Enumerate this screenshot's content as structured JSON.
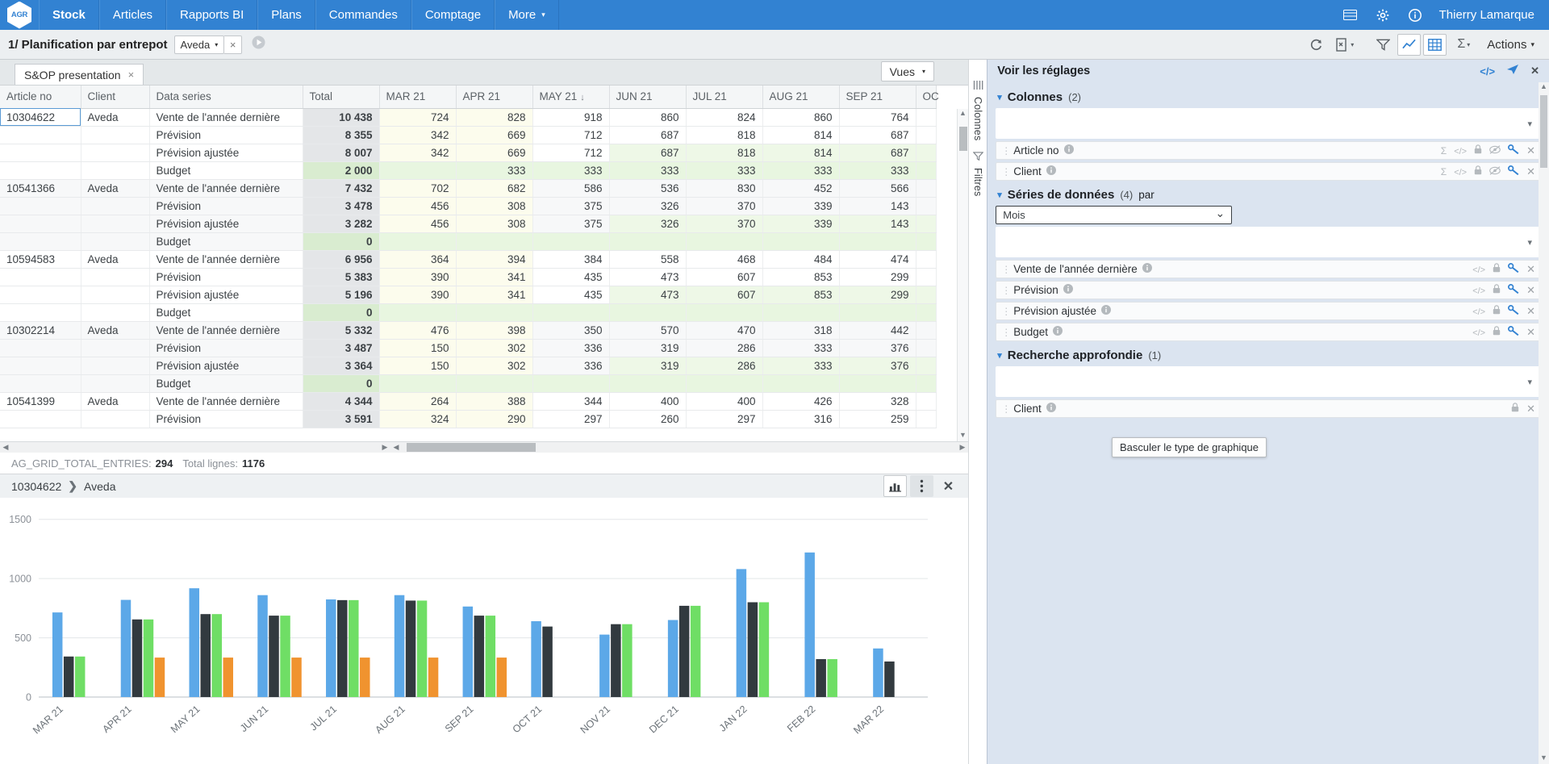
{
  "topnav": {
    "logo": "AGR",
    "items": [
      {
        "label": "Stock",
        "active": true
      },
      {
        "label": "Articles",
        "active": false
      },
      {
        "label": "Rapports BI",
        "active": false
      },
      {
        "label": "Plans",
        "active": false
      },
      {
        "label": "Commandes",
        "active": false
      },
      {
        "label": "Comptage",
        "active": false
      },
      {
        "label": "More",
        "active": false
      }
    ],
    "more_caret": "▾",
    "icons": [
      "book-icon",
      "gear-icon",
      "info-icon"
    ],
    "user": "Thierry Lamarque"
  },
  "titlebar": {
    "title": "1/ Planification par entrepot",
    "chip_label": "Aveda",
    "chip_caret": "▾",
    "chip_close": "×",
    "play_icon": "▶",
    "tools": [
      "refresh-icon",
      "export-icon",
      "filter-icon",
      "chart-icon",
      "grid-icon",
      "sigma-icon"
    ],
    "actions_label": "Actions",
    "actions_caret": "▾"
  },
  "tabs": {
    "items": [
      {
        "label": "S&OP presentation",
        "close": "×"
      }
    ],
    "vues_label": "Vues",
    "vues_caret": "▾"
  },
  "grid": {
    "columns": [
      "Article no",
      "Client",
      "Data series",
      "Total",
      "MAR 21",
      "APR 21",
      "MAY 21",
      "JUN 21",
      "JUL 21",
      "AUG 21",
      "SEP 21",
      "OC"
    ],
    "sorted_column": "MAY 21",
    "sort_arrow": "↓",
    "rows": [
      {
        "article": "10304622",
        "client": "Aveda",
        "series": "Vente de l'année dernière",
        "total": "10 438",
        "values": [
          "724",
          "828",
          "918",
          "860",
          "824",
          "860",
          "764",
          ""
        ]
      },
      {
        "article": "",
        "client": "",
        "series": "Prévision",
        "total": "8 355",
        "values": [
          "342",
          "669",
          "712",
          "687",
          "818",
          "814",
          "687",
          ""
        ]
      },
      {
        "article": "",
        "client": "",
        "series": "Prévision ajustée",
        "total": "8 007",
        "values": [
          "342",
          "669",
          "712",
          "687",
          "818",
          "814",
          "687",
          ""
        ]
      },
      {
        "article": "",
        "client": "",
        "series": "Budget",
        "total": "2 000",
        "values": [
          "",
          "333",
          "333",
          "333",
          "333",
          "333",
          "333",
          ""
        ]
      },
      {
        "article": "10541366",
        "client": "Aveda",
        "series": "Vente de l'année dernière",
        "total": "7 432",
        "values": [
          "702",
          "682",
          "586",
          "536",
          "830",
          "452",
          "566",
          ""
        ]
      },
      {
        "article": "",
        "client": "",
        "series": "Prévision",
        "total": "3 478",
        "values": [
          "456",
          "308",
          "375",
          "326",
          "370",
          "339",
          "143",
          ""
        ]
      },
      {
        "article": "",
        "client": "",
        "series": "Prévision ajustée",
        "total": "3 282",
        "values": [
          "456",
          "308",
          "375",
          "326",
          "370",
          "339",
          "143",
          ""
        ]
      },
      {
        "article": "",
        "client": "",
        "series": "Budget",
        "total": "0",
        "values": [
          "",
          "",
          "",
          "",
          "",
          "",
          "",
          ""
        ]
      },
      {
        "article": "10594583",
        "client": "Aveda",
        "series": "Vente de l'année dernière",
        "total": "6 956",
        "values": [
          "364",
          "394",
          "384",
          "558",
          "468",
          "484",
          "474",
          ""
        ]
      },
      {
        "article": "",
        "client": "",
        "series": "Prévision",
        "total": "5 383",
        "values": [
          "390",
          "341",
          "435",
          "473",
          "607",
          "853",
          "299",
          ""
        ]
      },
      {
        "article": "",
        "client": "",
        "series": "Prévision ajustée",
        "total": "5 196",
        "values": [
          "390",
          "341",
          "435",
          "473",
          "607",
          "853",
          "299",
          ""
        ]
      },
      {
        "article": "",
        "client": "",
        "series": "Budget",
        "total": "0",
        "values": [
          "",
          "",
          "",
          "",
          "",
          "",
          "",
          ""
        ]
      },
      {
        "article": "10302214",
        "client": "Aveda",
        "series": "Vente de l'année dernière",
        "total": "5 332",
        "values": [
          "476",
          "398",
          "350",
          "570",
          "470",
          "318",
          "442",
          ""
        ]
      },
      {
        "article": "",
        "client": "",
        "series": "Prévision",
        "total": "3 487",
        "values": [
          "150",
          "302",
          "336",
          "319",
          "286",
          "333",
          "376",
          ""
        ]
      },
      {
        "article": "",
        "client": "",
        "series": "Prévision ajustée",
        "total": "3 364",
        "values": [
          "150",
          "302",
          "336",
          "319",
          "286",
          "333",
          "376",
          ""
        ]
      },
      {
        "article": "",
        "client": "",
        "series": "Budget",
        "total": "0",
        "values": [
          "",
          "",
          "",
          "",
          "",
          "",
          "",
          ""
        ]
      },
      {
        "article": "10541399",
        "client": "Aveda",
        "series": "Vente de l'année dernière",
        "total": "4 344",
        "values": [
          "264",
          "388",
          "344",
          "400",
          "400",
          "426",
          "328",
          ""
        ]
      },
      {
        "article": "",
        "client": "",
        "series": "Prévision",
        "total": "3 591",
        "values": [
          "324",
          "290",
          "297",
          "260",
          "297",
          "316",
          "259",
          ""
        ]
      }
    ]
  },
  "sidestrip": {
    "columns_label": "Colonnes",
    "filters_label": "Filtres",
    "columns_icon": "columns-icon",
    "filters_icon": "funnel-icon"
  },
  "status": {
    "entries_label": "AG_GRID_TOTAL_ENTRIES:",
    "entries_value": "294",
    "rows_label": "Total lignes:",
    "rows_value": "1176"
  },
  "chart_header": {
    "article": "10304622",
    "chevron": "❯",
    "client": "Aveda",
    "toggle_chart_icon": "bar-chart-icon",
    "menu_icon": "kebab-menu-icon",
    "close_icon": "✕"
  },
  "tooltip": {
    "text": "Basculer le type de graphique"
  },
  "rightpanel": {
    "header": "Voir les réglages",
    "header_icons": [
      "code-icon",
      "send-icon",
      "close-icon"
    ],
    "sections": [
      {
        "title": "Colonnes",
        "count": "(2)",
        "caret": "▾",
        "suffix": "",
        "dropdown_value": "",
        "dropdown_caret": "▾",
        "fields": [
          {
            "label": "Article no",
            "info": "ℹ",
            "icons": [
              "sigma",
              "code",
              "lock",
              "hide",
              "link",
              "x"
            ]
          },
          {
            "label": "Client",
            "info": "ℹ",
            "icons": [
              "sigma",
              "code",
              "lock",
              "hide",
              "link",
              "x"
            ]
          }
        ]
      },
      {
        "title": "Séries de données",
        "count": "(4)",
        "caret": "▾",
        "suffix": "par",
        "select_value": "Mois",
        "select_caret": "⌄",
        "dropdown_value": "",
        "dropdown_caret": "▾",
        "fields": [
          {
            "label": "Vente de l'année dernière",
            "info": "ℹ",
            "icons": [
              "code",
              "lock",
              "link",
              "x"
            ]
          },
          {
            "label": "Prévision",
            "info": "ℹ",
            "icons": [
              "code",
              "lock",
              "link",
              "x"
            ]
          },
          {
            "label": "Prévision ajustée",
            "info": "ℹ",
            "icons": [
              "code",
              "lock",
              "link",
              "x"
            ]
          },
          {
            "label": "Budget",
            "info": "ℹ",
            "icons": [
              "code",
              "lock",
              "link",
              "x"
            ]
          }
        ]
      },
      {
        "title": "Recherche approfondie",
        "count": "(1)",
        "caret": "▾",
        "suffix": "",
        "dropdown_value": "",
        "dropdown_caret": "▾",
        "fields": [
          {
            "label": "Client",
            "info": "ℹ",
            "icons": [
              "lock",
              "x"
            ]
          }
        ]
      }
    ]
  },
  "chart_data": {
    "type": "bar",
    "title": "",
    "xlabel": "",
    "ylabel": "",
    "ylim": [
      0,
      1600
    ],
    "yticks": [
      0,
      500,
      1000,
      1500
    ],
    "grid": true,
    "legend_position": "right",
    "categories": [
      "MAR 21",
      "APR 21",
      "MAY 21",
      "JUN 21",
      "JUL 21",
      "AUG 21",
      "SEP 21",
      "OCT 21",
      "NOV 21",
      "DEC 21",
      "JAN 22",
      "FEB 22",
      "MAR 22"
    ],
    "series": [
      {
        "name": "Vente de l'année dernière",
        "color": "#5cA8E8",
        "values": [
          714,
          820,
          918,
          860,
          824,
          860,
          764,
          640,
          527,
          650,
          1080,
          1220,
          410
        ]
      },
      {
        "name": "Prévision",
        "color": "#323A3F",
        "values": [
          342,
          655,
          700,
          687,
          818,
          814,
          687,
          595,
          615,
          770,
          800,
          320,
          300
        ]
      },
      {
        "name": "Prévision ajustée",
        "color": "#6FDE65",
        "values": [
          342,
          655,
          700,
          687,
          818,
          814,
          687,
          0,
          615,
          770,
          800,
          320,
          0
        ]
      },
      {
        "name": "Budget",
        "color": "#F0932F",
        "values": [
          0,
          333,
          333,
          333,
          333,
          333,
          333,
          0,
          0,
          0,
          0,
          0,
          0
        ]
      }
    ]
  }
}
